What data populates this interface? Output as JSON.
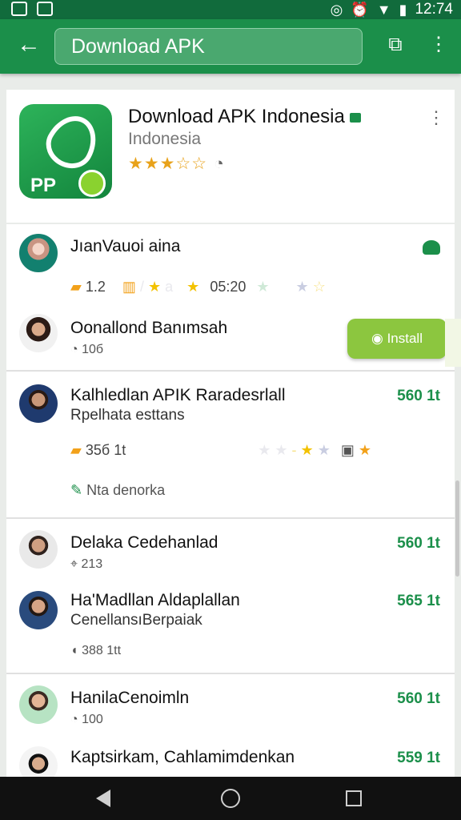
{
  "status_bar": {
    "time": "12:74"
  },
  "app_bar": {
    "search_text": "Download APK"
  },
  "app_header": {
    "title": "Download APK Indonesia",
    "subtitle": "Indonesia",
    "icon_text": "PP",
    "stars": "★★★☆☆"
  },
  "reviews": [
    {
      "name": "JıanVauoi aina",
      "rating_text": "1.2",
      "rating_time": "05:20"
    },
    {
      "name": "Oonallond Banımsah",
      "meta": "10б",
      "install_label": "Install"
    },
    {
      "name": "Kalhledlan APIK Raradesrlall",
      "sub": "Rpelhata esttans",
      "price": "560 1t",
      "meta": "35б 1t",
      "note": "Nta denorka"
    },
    {
      "name": "Delaka Cedehanlad",
      "meta": "213",
      "price": "560 1t"
    },
    {
      "name": "Ha'Madllan Aldaplallan",
      "sub": "CenellansıBerpaiak",
      "price": "565 1t",
      "meta": "388 1tt"
    },
    {
      "name": "HanilaCenoimln",
      "meta": "100",
      "price": "560 1t"
    },
    {
      "name": "Kaptsirkam, Cahlamimdenkan",
      "price": "559 1t"
    }
  ],
  "colors": {
    "brand_green": "#1b8f4a",
    "status_green": "#116b3c",
    "install_green": "#8cc63f",
    "star_gold": "#f3c200"
  },
  "icons": [
    "back-arrow-icon",
    "open-in-icon",
    "more-vert-icon",
    "clock-icon",
    "pin-icon",
    "nav-back-icon",
    "nav-home-icon",
    "nav-recent-icon"
  ]
}
